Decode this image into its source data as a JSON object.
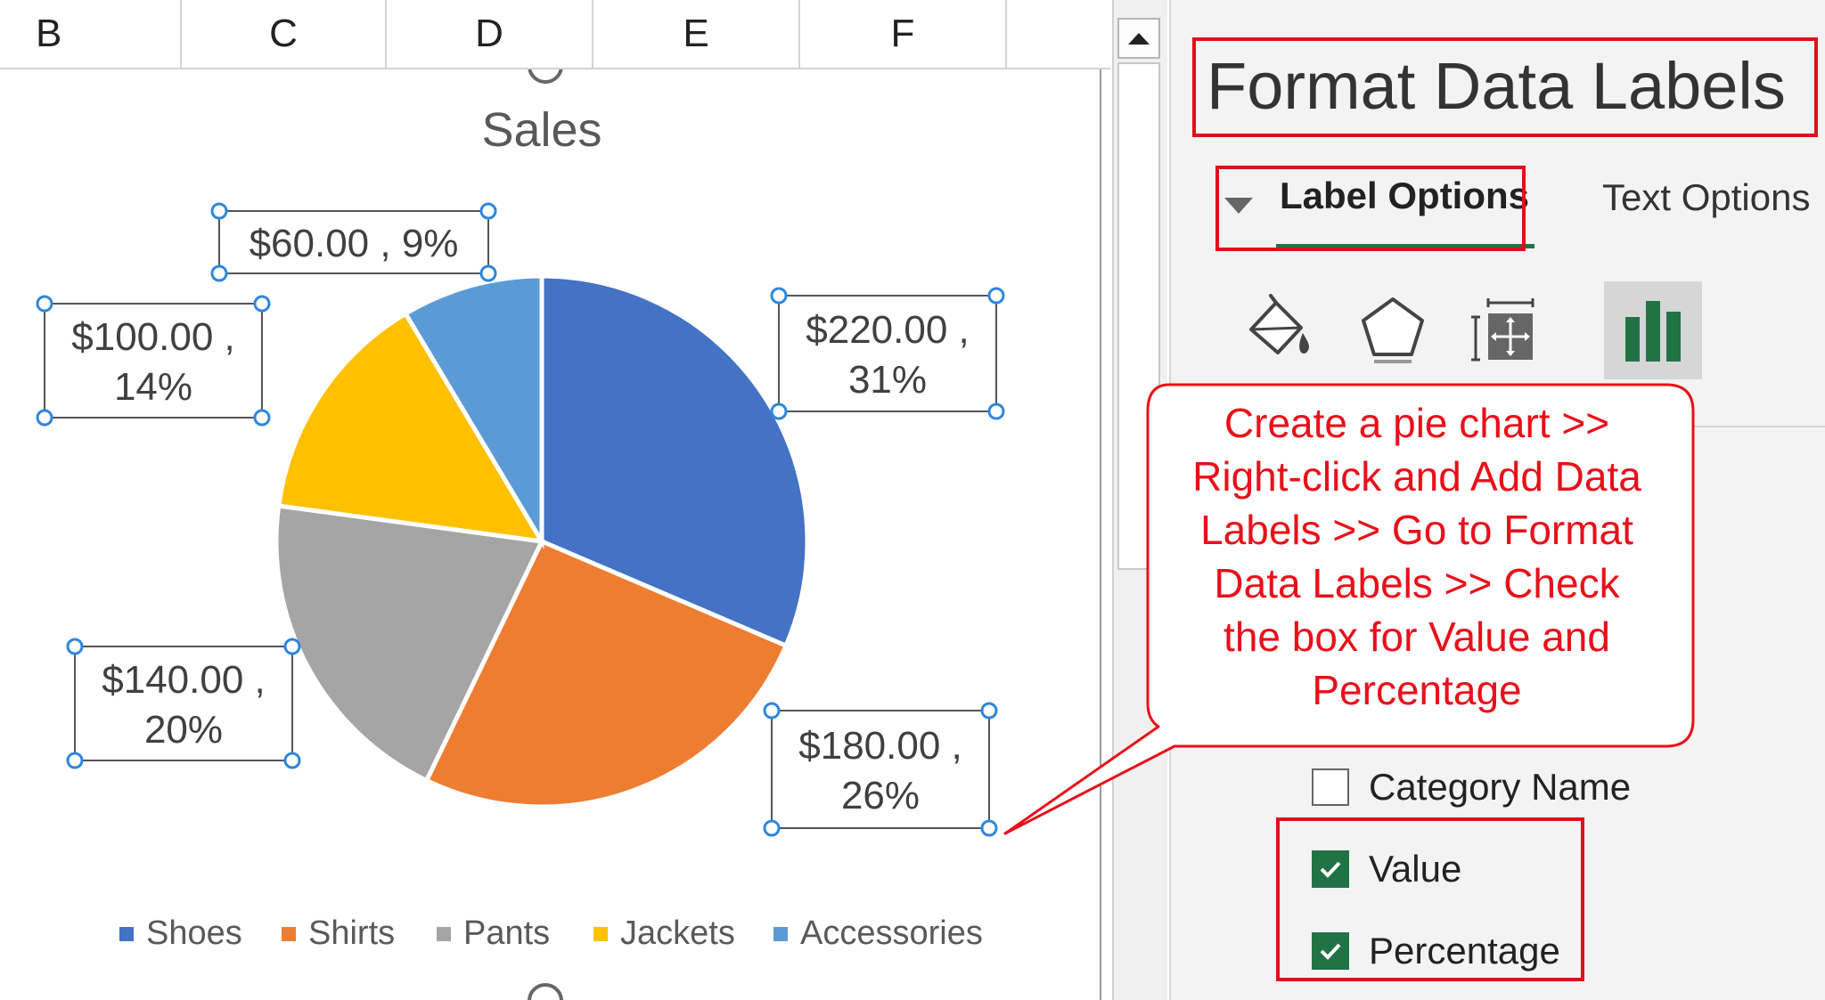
{
  "spreadsheet": {
    "columns": [
      "B",
      "C",
      "D",
      "E",
      "F"
    ]
  },
  "chart_data": {
    "type": "pie",
    "title": "Sales",
    "categories": [
      "Shoes",
      "Shirts",
      "Pants",
      "Jackets",
      "Accessories"
    ],
    "values": [
      220,
      180,
      140,
      100,
      60
    ],
    "percentages": [
      31,
      26,
      20,
      14,
      9
    ],
    "colors": [
      "#4472C4",
      "#ED7D31",
      "#A5A5A5",
      "#FFC000",
      "#5B9BD5"
    ],
    "data_labels": [
      [
        "$220.00 ,",
        "31%"
      ],
      [
        "$180.00 ,",
        "26%"
      ],
      [
        "$140.00 ,",
        "20%"
      ],
      [
        "$100.00 ,",
        "14%"
      ],
      [
        "$60.00 , 9%"
      ]
    ],
    "legend_position": "bottom"
  },
  "pane": {
    "title": "Format Data Labels",
    "tabs": [
      {
        "label": "Label Options",
        "active": true
      },
      {
        "label": "Text Options",
        "active": false
      }
    ],
    "icons": [
      "fill-line-icon",
      "effects-pentagon-icon",
      "size-properties-icon",
      "label-options-chart-icon"
    ],
    "checkboxes": [
      {
        "label": "Category Name",
        "checked": false
      },
      {
        "label": "Value",
        "checked": true
      },
      {
        "label": "Percentage",
        "checked": true
      }
    ]
  },
  "callout": {
    "lines": [
      "Create a pie chart >>",
      "Right-click and Add Data",
      "Labels >> Go to Format",
      "Data Labels  >> Check",
      "the box for Value and",
      "Percentage"
    ],
    "color": "#E8101A"
  },
  "accent_color": "#217346"
}
